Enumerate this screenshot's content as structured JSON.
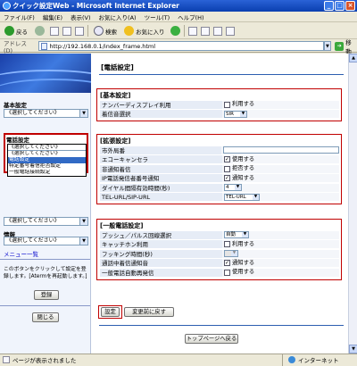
{
  "window": {
    "title": "クイック設定Web - Microsoft Internet Explorer",
    "minimize": "_",
    "maximize": "□",
    "close": "×"
  },
  "menu": [
    "ファイル(F)",
    "編集(E)",
    "表示(V)",
    "お気に入り(A)",
    "ツール(T)",
    "ヘルプ(H)"
  ],
  "toolbar": {
    "back": "戻る",
    "search": "検索",
    "favorites": "お気に入り"
  },
  "address": {
    "label": "アドレス(D)",
    "url": "http://192.168.0.1/index_frame.html",
    "go": "移動"
  },
  "left": {
    "basic_label": "基本設定",
    "basic_select": "《選択してください》",
    "phone_label": "電話設定",
    "phone_select": "《選択してください》",
    "phone_options": [
      "《選択してください》",
      "電話設定",
      "特定番号着信拒否設定",
      "一般電話接続設定"
    ],
    "hidden_select": "《選択してください》",
    "info_label": "情報",
    "info_select": "《選択してください》",
    "menu_link": "メニュー一覧",
    "note": "このボタンをクリックして設定を登録します。[Atermを再起動します。]",
    "register": "登録",
    "close": "閉じる"
  },
  "main": {
    "title": "[電話設定]",
    "basic": {
      "title": "[基本設定]",
      "rows": [
        {
          "label": "ナンバーディスプレイ利用",
          "value": "利用する",
          "checked": false
        },
        {
          "label": "着信音選択",
          "value": "SIR"
        }
      ]
    },
    "ext": {
      "title": "[拡張設定]",
      "rows": [
        {
          "label": "市外局番",
          "value": ""
        },
        {
          "label": "エコーキャンセラ",
          "value": "使用する",
          "checked": true
        },
        {
          "label": "非通知着信",
          "value": "拒否する",
          "checked": false
        },
        {
          "label": "IP電話発信者番号通知",
          "value": "通知する",
          "checked": true
        },
        {
          "label": "ダイヤル間隔有効時間(秒)",
          "value": "4"
        },
        {
          "label": "TEL-URL/SIP-URL",
          "value": "TEL-URL"
        }
      ]
    },
    "general": {
      "title": "[一般電話設定]",
      "rows": [
        {
          "label": "プッシュ／パルス回線選択",
          "value": "自動"
        },
        {
          "label": "キャッチホン利用",
          "value": "利用する",
          "checked": false
        },
        {
          "label": "フッキング時間(秒)",
          "value": ""
        },
        {
          "label": "通話中着信通知音",
          "value": "通知する",
          "checked": true
        },
        {
          "label": "一般電話自動再発信",
          "value": "使用する",
          "checked": false
        }
      ]
    },
    "set_button": "設定",
    "revert_button": "変更前に戻す",
    "top_button": "トップページへ戻る"
  },
  "status": {
    "left": "ページが表示されました",
    "right": "インターネット"
  }
}
